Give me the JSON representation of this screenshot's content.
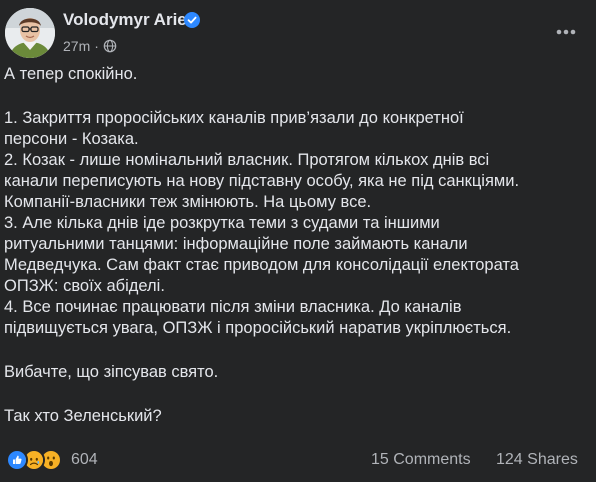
{
  "post": {
    "author": "Volodymyr Ariev",
    "time": "27m",
    "separator": "·",
    "verified_icon": "verified-badge-icon",
    "privacy_icon": "globe-icon",
    "paragraphs": [
      [
        "А тепер спокійно."
      ],
      [
        "1. Закриття проросійських каналів прив’язали до конкретної",
        "персони - Козака.",
        "2. Козак - лише номінальний власник. Протягом кількох днів всі",
        "канали переписують на нову підставну особу, яка не під санкціями.",
        "Компанії-власники теж змінюють. На цьому все.",
        "3. Але кілька днів іде розкрутка теми з судами та іншими",
        "ритуальними танцями: інформаційне поле займають канали",
        "Медведчука. Сам факт стає приводом для консолідації електората",
        "ОПЗЖ: своїх абіделі.",
        "4. Все починає працювати після зміни власника. До каналів",
        "підвищується увага, ОПЗЖ і проросійський наратив укріплюється."
      ],
      [
        "Вибачте, що зіпсував свято."
      ],
      [
        "Так хто Зеленський?"
      ]
    ]
  },
  "footer": {
    "reaction_icons": [
      "like-icon",
      "sad-icon",
      "wow-icon"
    ],
    "reaction_count": "604",
    "comments": "15 Comments",
    "shares": "124 Shares"
  },
  "colors": {
    "background": "#242526",
    "text": "#e4e6eb",
    "secondary_text": "#b0b3b8",
    "accent": "#2d88ff",
    "reaction_yellow": "#f7b125"
  }
}
